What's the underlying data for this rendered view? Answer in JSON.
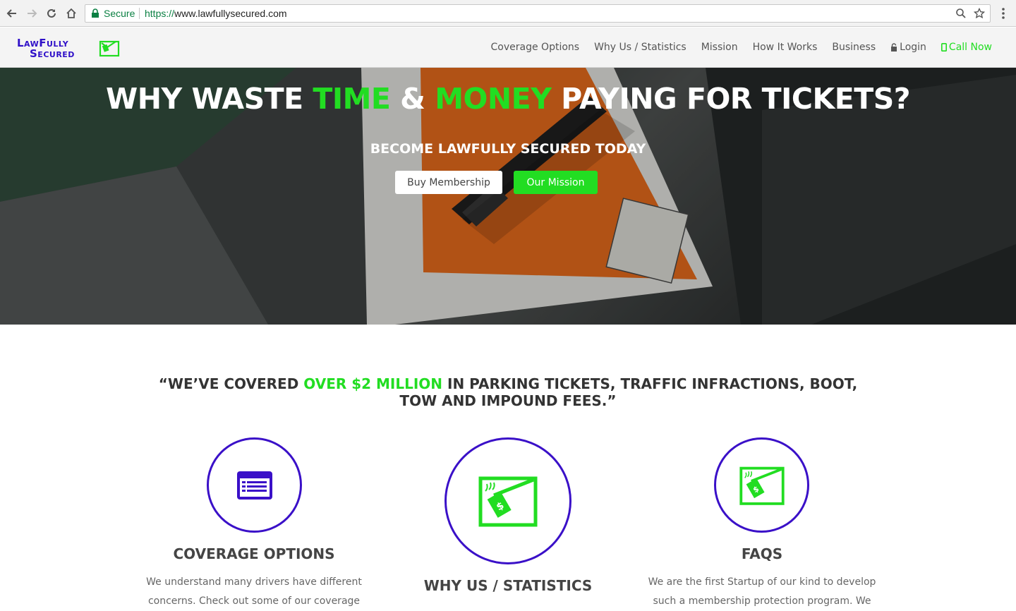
{
  "browser": {
    "secure_label": "Secure",
    "url_scheme": "https://",
    "url_rest": "www.lawfullysecured.com"
  },
  "header": {
    "logo_line1": "LawFully",
    "logo_line2": "Secured",
    "nav": [
      {
        "label": "Coverage Options"
      },
      {
        "label": "Why Us / Statistics"
      },
      {
        "label": "Mission"
      },
      {
        "label": "How It Works"
      },
      {
        "label": "Business"
      },
      {
        "label": "Login",
        "icon": "lock-icon"
      },
      {
        "label": "Call Now",
        "icon": "phone-icon"
      }
    ]
  },
  "hero": {
    "title_a": "WHY WASTE ",
    "title_b": "TIME",
    "title_c": " & ",
    "title_d": "MONEY",
    "title_e": " PAYING FOR TICKETS?",
    "subtitle": "BECOME LAWFULLY SECURED TODAY",
    "buy_button": "Buy Membership",
    "mission_button": "Our Mission"
  },
  "quote": {
    "part_a": "“WE’VE COVERED ",
    "part_b": "OVER $2 MILLION",
    "part_c": " IN PARKING TICKETS, TRAFFIC INFRACTIONS, BOOT, TOW AND IMPOUND FEES.”"
  },
  "features": [
    {
      "title": "COVERAGE OPTIONS",
      "text": "We understand many drivers have different concerns. Check out some of our coverage",
      "icon": "list-icon"
    },
    {
      "title": "WHY US / STATISTICS",
      "text": "",
      "icon": "ticket-icon"
    },
    {
      "title": "FAQS",
      "text": "We are the first Startup of our kind to develop such a membership protection program. We",
      "icon": "ticket-icon"
    }
  ],
  "colors": {
    "accent_green": "#22dd22",
    "brand_purple": "#3a10c8"
  }
}
